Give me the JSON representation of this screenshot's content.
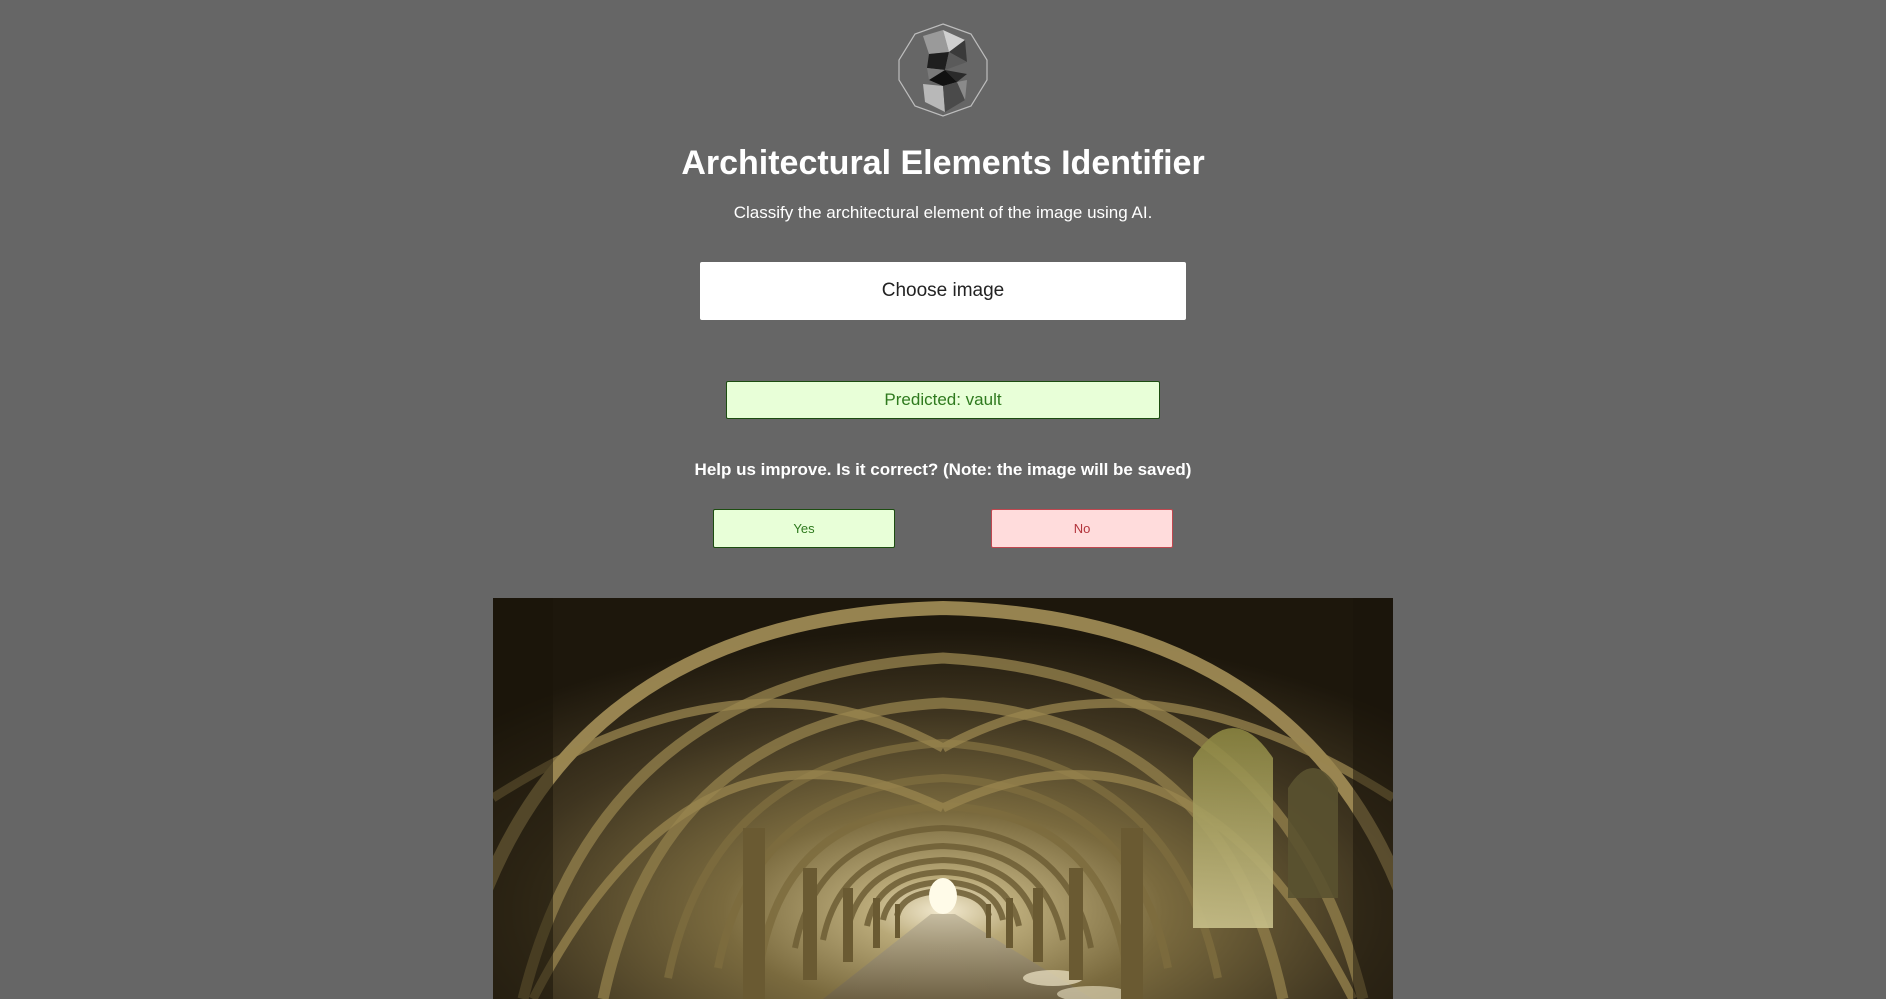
{
  "app": {
    "logo_icon": "geometric-polyhedron-logo-icon",
    "title": "Architectural Elements Identifier",
    "subtitle": "Classify the architectural element of the image using AI."
  },
  "upload": {
    "button_label": "Choose image"
  },
  "result": {
    "prediction_text": "Predicted: vault"
  },
  "feedback": {
    "prompt": "Help us improve. Is it correct? (Note: the image will be saved)",
    "yes_label": "Yes",
    "no_label": "No"
  },
  "preview": {
    "image_subject": "stone-vaulted-cellarium-corridor-image"
  },
  "colors": {
    "background": "#666666",
    "success_bg": "#e8ffd8",
    "success_text": "#2e7a1e",
    "danger_bg": "#ffdcdc",
    "danger_text": "#b3343c"
  }
}
